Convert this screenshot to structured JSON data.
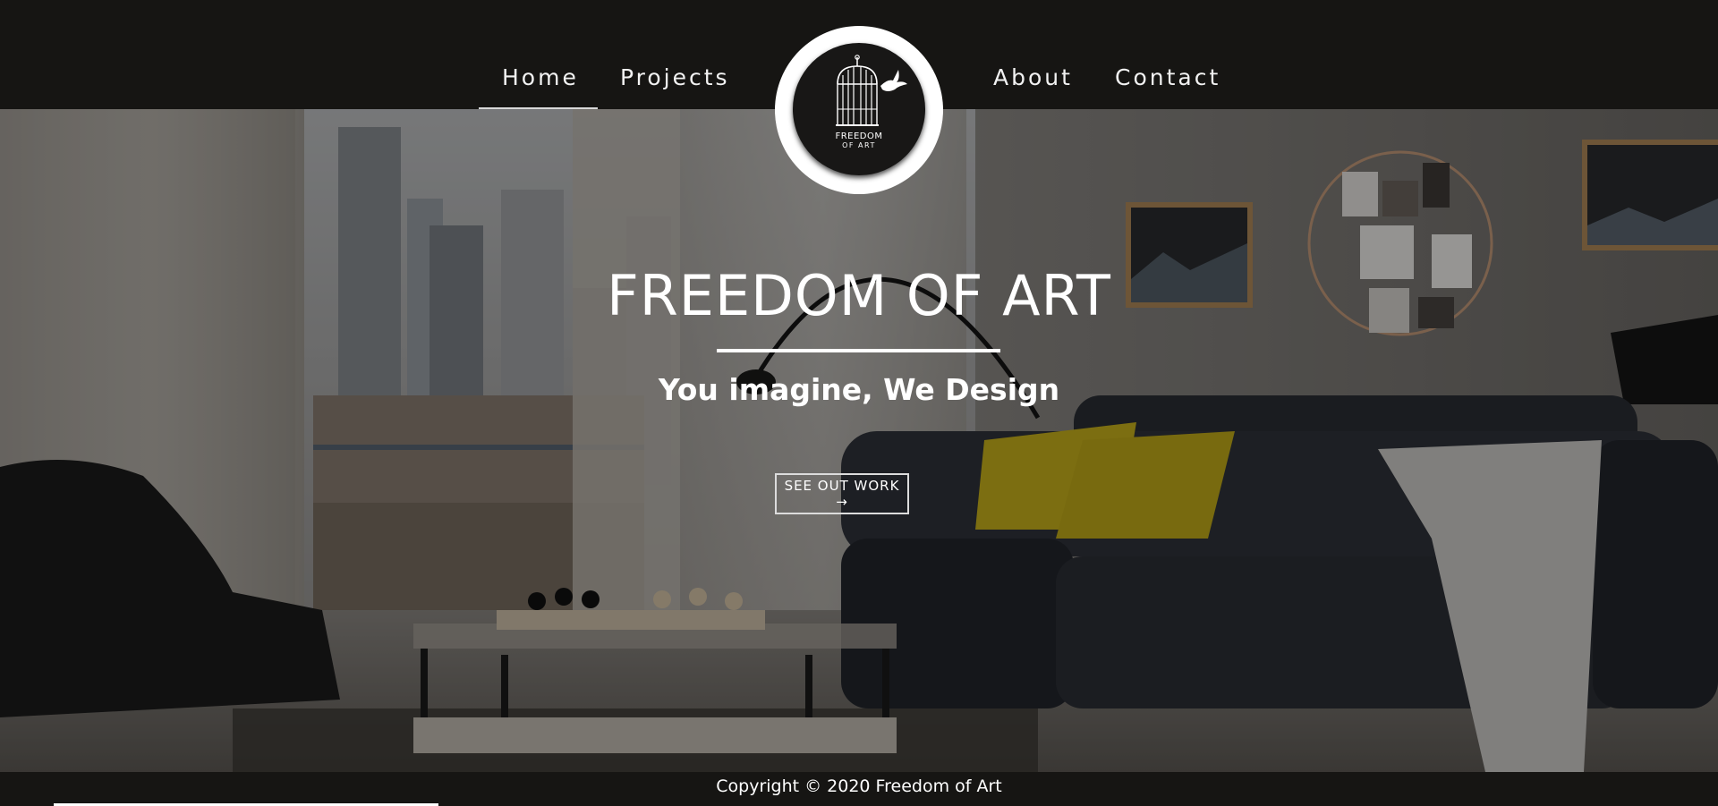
{
  "nav": {
    "items": [
      {
        "label": "Home",
        "active": true
      },
      {
        "label": "Projects"
      },
      {
        "label": "About"
      },
      {
        "label": "Contact"
      }
    ]
  },
  "logo": {
    "line1": "FREEDOM",
    "line2": "OF ART",
    "icon": "birdcage-icon"
  },
  "hero": {
    "title": "FREEDOM OF ART",
    "subtitle": "You imagine, We Design",
    "cta_label": "SEE OUT WORK →"
  },
  "footer": {
    "copyright": "Copyright © 2020 Freedom of Art"
  },
  "colors": {
    "header_bg": "#161513",
    "text": "#ffffff",
    "pillow_accent": "#c9b21c",
    "sofa": "#2b2e35"
  }
}
